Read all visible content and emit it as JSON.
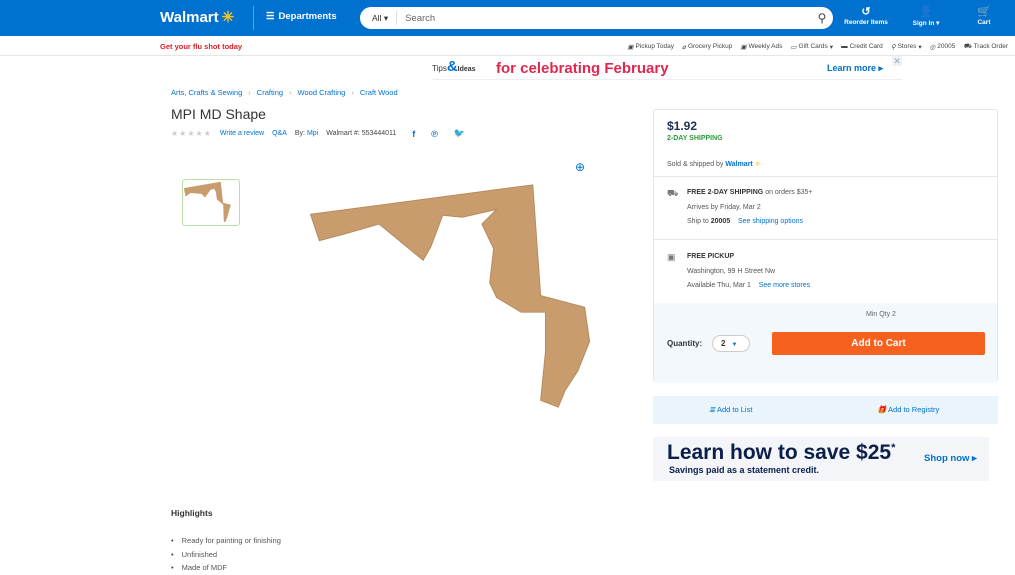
{
  "header": {
    "logo": "Walmart",
    "departments": "Departments",
    "search_scope": "All",
    "search_placeholder": "Search",
    "reorder": "Reorder Items",
    "signin": "Sign In",
    "cart": "Cart"
  },
  "subbar": {
    "promo": "Get your flu shot today",
    "links": [
      "Pickup Today",
      "Grocery Pickup",
      "Weekly Ads",
      "Gift Cards",
      "Credit Card",
      "Stores",
      "20005",
      "Track Order"
    ]
  },
  "banner": {
    "tips": "Tips",
    "amp": "&",
    "ideas": "Ideas",
    "headline": "for celebrating February",
    "cta": "Learn more ▸",
    "close": "✕"
  },
  "breadcrumb": [
    "Arts, Crafts & Sewing",
    "Crafting",
    "Wood Crafting",
    "Craft Wood"
  ],
  "product": {
    "title": "MPI MD Shape",
    "stars": "★★★★★",
    "write_review": "Write a review",
    "qa": "Q&A",
    "by_label": "By:",
    "brand": "Mpi",
    "walmart_num": "Walmart #: 553444011",
    "colors": {
      "wood": "#c99c6e"
    }
  },
  "buybox": {
    "price": "$1.92",
    "shipping_badge": "2-DAY SHIPPING",
    "sold_by_label": "Sold & shipped by",
    "seller": "Walmart",
    "ship_title": "FREE 2-DAY SHIPPING",
    "ship_suffix": "on orders $35+",
    "arrives": "Arrives by Friday, Mar 2",
    "ship_to_label": "Ship to",
    "ship_zip": "20005",
    "ship_options": "See shipping options",
    "pickup_title": "FREE PICKUP",
    "pickup_store": "Washington, 99 H Street Nw",
    "pickup_avail": "Available Thu, Mar 1",
    "more_stores": "See more stores",
    "min_qty": "Min Qty 2",
    "qty_label": "Quantity:",
    "qty_value": "2",
    "add_to_cart": "Add to Cart",
    "add_to_list": "Add to List",
    "add_to_registry": "Add to Registry"
  },
  "promo": {
    "headline": "Learn how to save $25",
    "asterisk": "*",
    "sub": "Savings paid as a statement credit.",
    "cta": "Shop now ▸"
  },
  "highlights": {
    "title": "Highlights",
    "items": [
      "Ready for painting or finishing",
      "Unfinished",
      "Made of MDF"
    ]
  }
}
